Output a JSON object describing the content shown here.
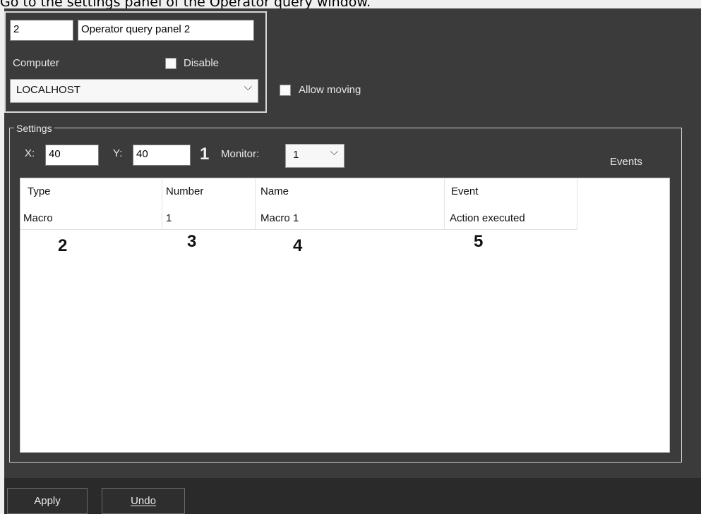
{
  "caption": "Go to the settings panel of the Operator query window.",
  "panel": {
    "id_value": "2",
    "name_value": "Operator query panel 2",
    "computer_label": "Computer",
    "disable_label": "Disable",
    "disable_checked": false,
    "computer_value": "LOCALHOST",
    "allow_moving_label": "Allow moving",
    "allow_moving_checked": false
  },
  "settings": {
    "group_label": "Settings",
    "x_label": "X:",
    "x_value": "40",
    "y_label": "Y:",
    "y_value": "40",
    "monitor_label": "Monitor:",
    "monitor_value": "1",
    "events_label": "Events"
  },
  "table": {
    "columns": [
      "Type",
      "Number",
      "Name",
      "Event"
    ],
    "rows": [
      [
        "Macro",
        "1",
        "Macro 1",
        "Action executed"
      ]
    ]
  },
  "markers": [
    "1",
    "2",
    "3",
    "4",
    "5"
  ],
  "buttons": {
    "apply": "Apply",
    "undo": "Undo"
  },
  "icons": {
    "dropdown": "chevron-down-icon"
  },
  "colors": {
    "panel_background": "#3b3b3b",
    "table_background": "#ffffff",
    "frame_border": "#d8d8d8"
  }
}
